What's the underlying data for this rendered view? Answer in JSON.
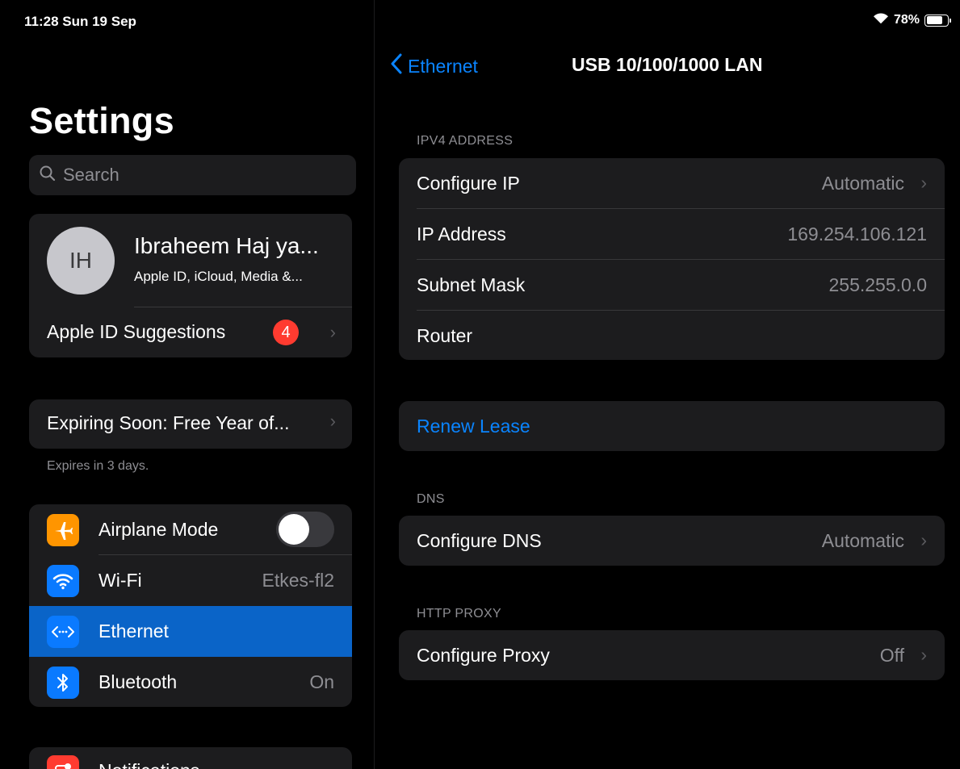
{
  "status": {
    "time": "11:28  Sun 19 Sep",
    "battery_pct": "78%",
    "battery_level": 0.78
  },
  "sidebar": {
    "title": "Settings",
    "search_placeholder": "Search",
    "profile": {
      "initials": "IH",
      "name": "Ibraheem Haj ya...",
      "subtitle": "Apple ID, iCloud, Media &..."
    },
    "suggestions": {
      "label": "Apple ID Suggestions",
      "badge": "4"
    },
    "expiring": {
      "label": "Expiring Soon: Free Year of...",
      "note": "Expires in 3 days."
    },
    "network_items": [
      {
        "label": "Airplane Mode",
        "value": "",
        "icon": "airplane-icon",
        "icon_color": "#ff9500",
        "toggle_on": false
      },
      {
        "label": "Wi-Fi",
        "value": "Etkes-fl2",
        "icon": "wifi-icon",
        "icon_color": "#0a7aff"
      },
      {
        "label": "Ethernet",
        "value": "",
        "icon": "ethernet-icon",
        "icon_color": "#0a7aff",
        "selected": true
      },
      {
        "label": "Bluetooth",
        "value": "On",
        "icon": "bluetooth-icon",
        "icon_color": "#0a7aff"
      }
    ],
    "notifications": {
      "label": "Notifications",
      "icon": "notifications-icon",
      "icon_color": "#ff3b30"
    }
  },
  "detail": {
    "back_label": "Ethernet",
    "title": "USB 10/100/1000 LAN",
    "ipv4_header": "IPV4 ADDRESS",
    "ipv4_rows": [
      {
        "label": "Configure IP",
        "value": "Automatic",
        "chevron": true
      },
      {
        "label": "IP Address",
        "value": "169.254.106.121"
      },
      {
        "label": "Subnet Mask",
        "value": "255.255.0.0"
      },
      {
        "label": "Router",
        "value": ""
      }
    ],
    "renew_label": "Renew Lease",
    "dns_header": "DNS",
    "dns_row": {
      "label": "Configure DNS",
      "value": "Automatic"
    },
    "proxy_header": "HTTP PROXY",
    "proxy_row": {
      "label": "Configure Proxy",
      "value": "Off"
    }
  },
  "colors": {
    "accent": "#0a84ff",
    "selected_row": "#0a64c8",
    "cell_bg": "#1c1c1e",
    "badge": "#ff3b30"
  }
}
